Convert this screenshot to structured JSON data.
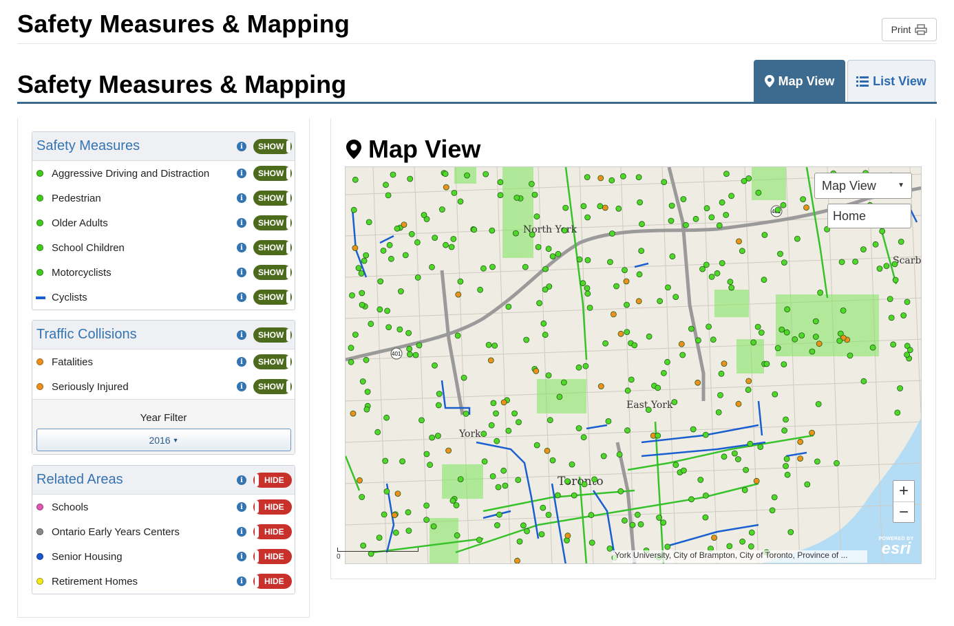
{
  "header": {
    "title": "Safety Measures & Mapping",
    "print_label": "Print"
  },
  "section": {
    "title": "Safety Measures & Mapping",
    "tabs": [
      {
        "label": "Map View",
        "active": true
      },
      {
        "label": "List View",
        "active": false
      }
    ]
  },
  "sidebar": {
    "safety_measures": {
      "title": "Safety Measures",
      "toggle": "SHOW",
      "items": [
        {
          "label": "Aggressive Driving and Distraction",
          "toggle": "SHOW",
          "color": "#3ecc1a"
        },
        {
          "label": "Pedestrian",
          "toggle": "SHOW",
          "color": "#3ecc1a"
        },
        {
          "label": "Older Adults",
          "toggle": "SHOW",
          "color": "#3ecc1a"
        },
        {
          "label": "School Children",
          "toggle": "SHOW",
          "color": "#3ecc1a"
        },
        {
          "label": "Motorcyclists",
          "toggle": "SHOW",
          "color": "#3ecc1a"
        },
        {
          "label": "Cyclists",
          "toggle": "SHOW",
          "color": "#1a5fd0"
        }
      ]
    },
    "traffic_collisions": {
      "title": "Traffic Collisions",
      "toggle": "SHOW",
      "items": [
        {
          "label": "Fatalities",
          "toggle": "SHOW",
          "color": "#f0901c"
        },
        {
          "label": "Seriously Injured",
          "toggle": "SHOW",
          "color": "#f0901c"
        }
      ],
      "year_filter_label": "Year Filter",
      "year_filter_value": "2016"
    },
    "related_areas": {
      "title": "Related Areas",
      "toggle": "HIDE",
      "items": [
        {
          "label": "Schools",
          "toggle": "HIDE",
          "color": "#e055b5"
        },
        {
          "label": "Ontario Early Years Centers",
          "toggle": "HIDE",
          "color": "#888888"
        },
        {
          "label": "Senior Housing",
          "toggle": "HIDE",
          "color": "#1a55d0"
        },
        {
          "label": "Retirement Homes",
          "toggle": "HIDE",
          "color": "#f2ea1a"
        }
      ]
    }
  },
  "map": {
    "title": "Map View",
    "basemap_select": "Map View",
    "location_input": "Home",
    "zoom_in": "+",
    "zoom_out": "−",
    "attribution": "York University, City of Brampton, City of Toronto, Province of ...",
    "esri_powered": "POWERED BY",
    "esri_logo": "esri",
    "scale_zero": "0",
    "place_labels": [
      "North York",
      "York",
      "Toronto",
      "East York",
      "Scarbo"
    ],
    "highway_labels": [
      "401",
      "401"
    ]
  }
}
